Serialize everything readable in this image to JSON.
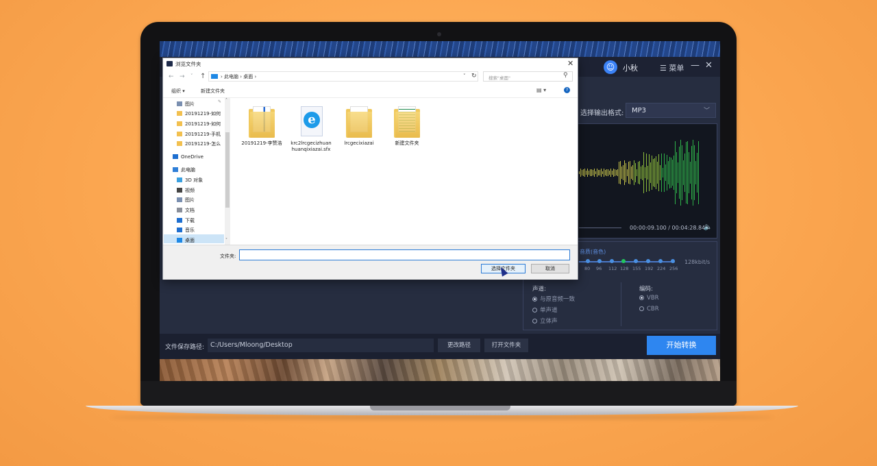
{
  "app": {
    "user_name": "小秋",
    "menu_label": "☰ 菜单",
    "minimize_glyph": "—",
    "close_glyph": "✕",
    "output_format_label": "选择输出格式:",
    "output_format_value": "MP3",
    "time_display": "00:00:09.100 / 00:04:28.840",
    "quality_label": "音质(音色)",
    "bitrate_ticks": [
      "80",
      "96",
      "112",
      "128",
      "155",
      "192",
      "224",
      "256"
    ],
    "bitrate_value": "128kbit/s",
    "channel_label": "声道:",
    "channel_options": [
      "与原音频一致",
      "单声道",
      "立体声"
    ],
    "channel_selected": 0,
    "codec_label": "编码:",
    "codec_options": [
      "VBR",
      "CBR"
    ],
    "codec_selected": 0,
    "save_path_label": "文件保存路径:",
    "save_path_value": "C:/Users/Mloong/Desktop",
    "change_path_label": "更改路径",
    "open_folder_label": "打开文件夹",
    "start_label": "开始转换",
    "accent_color": "#2e86f0"
  },
  "dialog": {
    "title": "浏览文件夹",
    "address": "› 此电脑 › 桌面 ›",
    "search_placeholder": "搜索\"桌面\"",
    "organize_label": "组织 ▾",
    "new_folder_label": "新建文件夹",
    "nav_items": [
      {
        "label": "图片",
        "icon": "pictures-icon"
      },
      {
        "label": "20191219-如何",
        "icon": "folder-icon"
      },
      {
        "label": "20191219-如何",
        "icon": "folder-icon"
      },
      {
        "label": "20191219-手机",
        "icon": "folder-icon"
      },
      {
        "label": "20191219-怎么",
        "icon": "folder-icon"
      },
      {
        "label": "OneDrive",
        "icon": "cloud-icon"
      },
      {
        "label": "此电脑",
        "icon": "computer-icon"
      },
      {
        "label": "3D 对象",
        "icon": "3d-objects-icon"
      },
      {
        "label": "视频",
        "icon": "video-icon"
      },
      {
        "label": "图片",
        "icon": "pictures-icon"
      },
      {
        "label": "文档",
        "icon": "documents-icon"
      },
      {
        "label": "下载",
        "icon": "download-icon"
      },
      {
        "label": "音乐",
        "icon": "music-icon"
      },
      {
        "label": "桌面",
        "icon": "desktop-icon"
      }
    ],
    "files": [
      {
        "label": "20191219-李赞浩",
        "type": "folder-docs"
      },
      {
        "label": "krc2lrcgecizhuanhuanqixiazai.sfx",
        "type": "ie-file"
      },
      {
        "label": "lrcgecixiazai",
        "type": "folder-blank"
      },
      {
        "label": "新建文件夹",
        "type": "folder-sheet"
      }
    ],
    "folder_field_label": "文件夹:",
    "folder_field_value": "",
    "select_button": "选择文件夹",
    "cancel_button": "取消"
  }
}
